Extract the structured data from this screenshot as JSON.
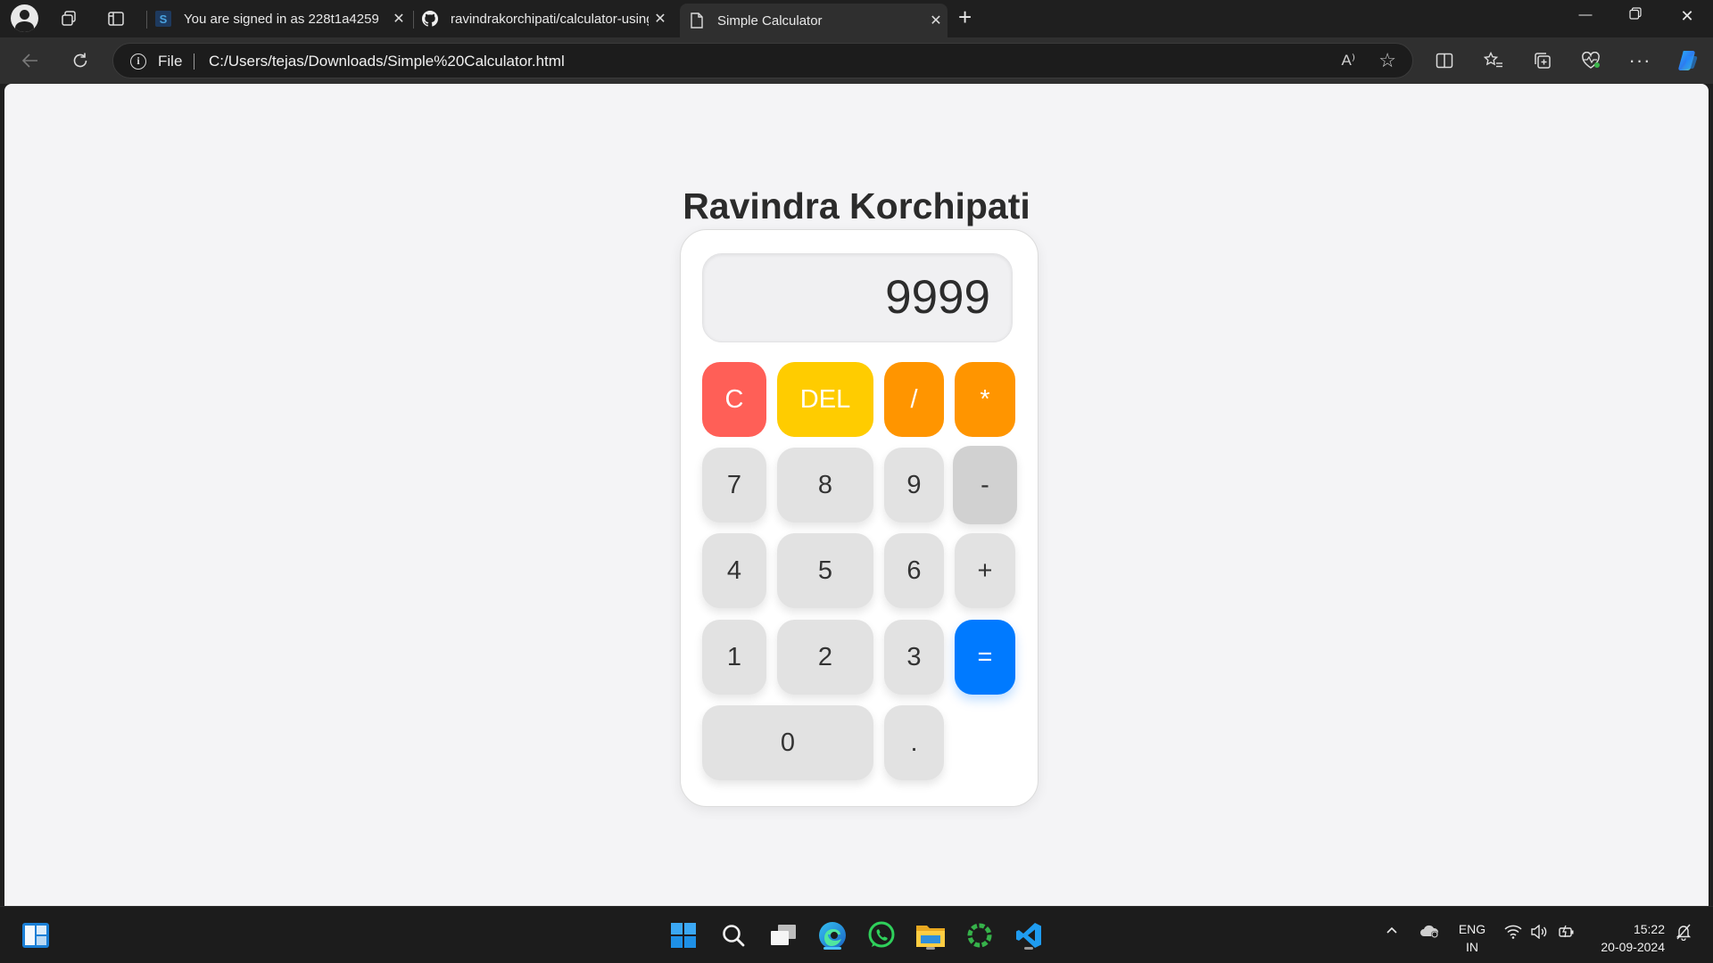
{
  "browser": {
    "tabs": [
      {
        "title": "You are signed in as 228t1a4259",
        "favicon": "s-icon",
        "close": "✕"
      },
      {
        "title": "ravindrakorchipati/calculator-using-html",
        "favicon": "github-icon",
        "close": "✕"
      },
      {
        "title": "Simple Calculator",
        "favicon": "page-icon",
        "close": "✕"
      }
    ],
    "new_tab": "+",
    "address": {
      "scheme_label": "File",
      "url": "C:/Users/tejas/Downloads/Simple%20Calculator.html"
    },
    "read_aloud": "A⁾"
  },
  "page": {
    "title": "Ravindra Korchipati",
    "display_value": "9999",
    "keys": {
      "clear": "C",
      "del": "DEL",
      "divide": "/",
      "multiply": "*",
      "seven": "7",
      "eight": "8",
      "nine": "9",
      "minus": "-",
      "four": "4",
      "five": "5",
      "six": "6",
      "plus": "+",
      "one": "1",
      "two": "2",
      "three": "3",
      "equals": "=",
      "zero": "0",
      "dot": "."
    },
    "colors": {
      "clear": "#ff5f57",
      "del": "#ffcc00",
      "operator": "#ff9500",
      "equals": "#007aff"
    }
  },
  "taskbar": {
    "lang_line1": "ENG",
    "lang_line2": "IN",
    "time": "15:22",
    "date": "20-09-2024"
  }
}
